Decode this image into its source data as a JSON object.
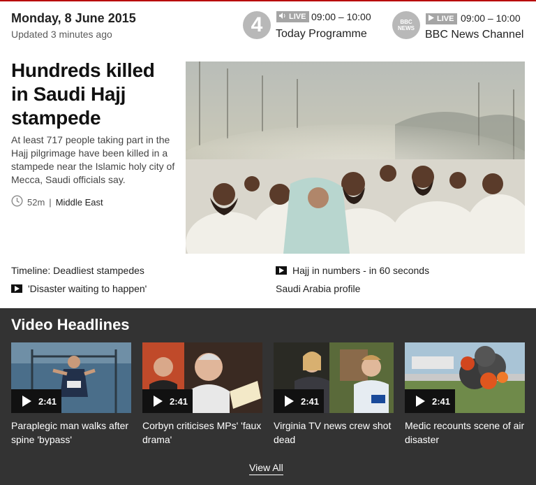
{
  "header": {
    "date": "Monday, 8 June 2015",
    "updated": "Updated 3 minutes ago"
  },
  "live": [
    {
      "channel_logo": "4",
      "badge": "LIVE",
      "time": "09:00 – 10:00",
      "programme": "Today Programme"
    },
    {
      "channel_logo_line1": "BBC",
      "channel_logo_line2": "NEWS",
      "badge": "LIVE",
      "time": "09:00 – 10:00",
      "programme": "BBC News Channel"
    }
  ],
  "lead": {
    "headline": "Hundreds killed in Saudi Hajj stampede",
    "summary": "At least 717 people taking part in the Hajj pilgrimage have been killed in a stampede near the Islamic holy city of Mecca, Saudi officials say.",
    "age": "52m",
    "section": "Middle East",
    "image_icon": "crowd-photo"
  },
  "related": [
    {
      "label": "Timeline: Deadliest stampedes",
      "video": false
    },
    {
      "label": "Hajj in numbers - in 60 seconds",
      "video": true
    },
    {
      "label": "'Disaster waiting to happen'",
      "video": true
    },
    {
      "label": "Saudi Arabia profile",
      "video": false
    }
  ],
  "video_headlines": {
    "title": "Video Headlines",
    "items": [
      {
        "duration": "2:41",
        "title": "Paraplegic man walks after spine 'bypass'"
      },
      {
        "duration": "2:41",
        "title": "Corbyn criticises MPs' 'faux drama'"
      },
      {
        "duration": "2:41",
        "title": "Virginia TV news crew shot dead"
      },
      {
        "duration": "2:41",
        "title": "Medic recounts scene of air disaster"
      }
    ],
    "view_all": "View All"
  },
  "colors": {
    "accent": "#b80000",
    "dark_band": "#333333",
    "live_badge": "#a5a5a5"
  }
}
